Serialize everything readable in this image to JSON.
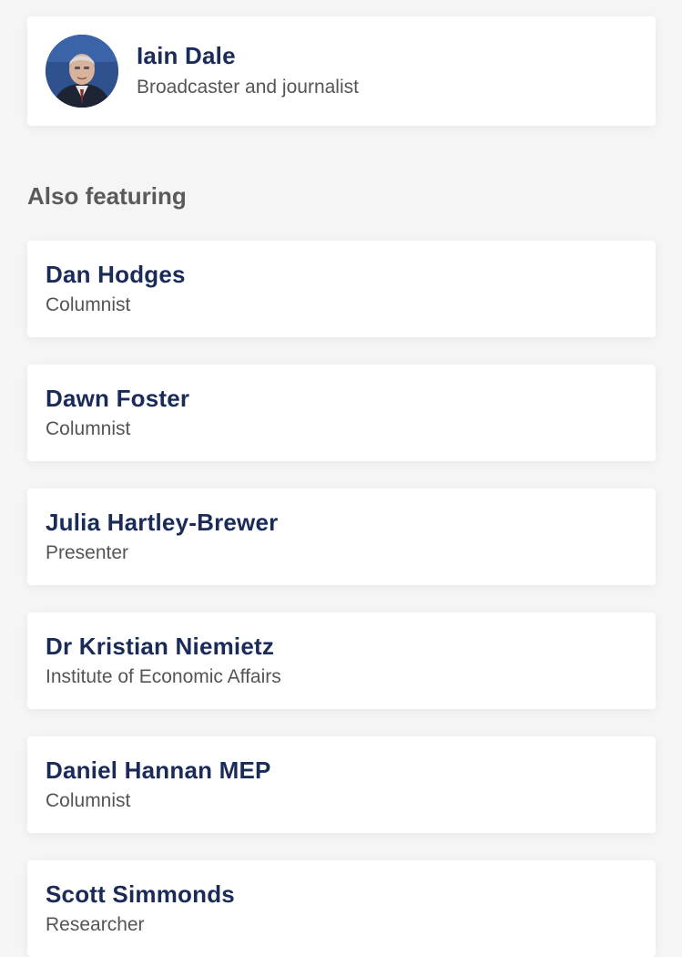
{
  "host": {
    "name": "Iain Dale",
    "role": "Broadcaster and journalist",
    "avatar_icon": "person-avatar"
  },
  "also_featuring": {
    "title": "Also featuring",
    "guests": [
      {
        "name": "Dan Hodges",
        "role": "Columnist"
      },
      {
        "name": "Dawn Foster",
        "role": "Columnist"
      },
      {
        "name": "Julia Hartley-Brewer",
        "role": "Presenter"
      },
      {
        "name": "Dr Kristian Niemietz",
        "role": "Institute of Economic Affairs"
      },
      {
        "name": "Daniel Hannan MEP",
        "role": "Columnist"
      },
      {
        "name": "Scott Simmonds",
        "role": "Researcher"
      }
    ]
  },
  "colors": {
    "name_text": "#1b2b58",
    "role_text": "#555555",
    "section_title": "#5a5a5a",
    "background": "#f5f5f5",
    "card": "#ffffff"
  }
}
